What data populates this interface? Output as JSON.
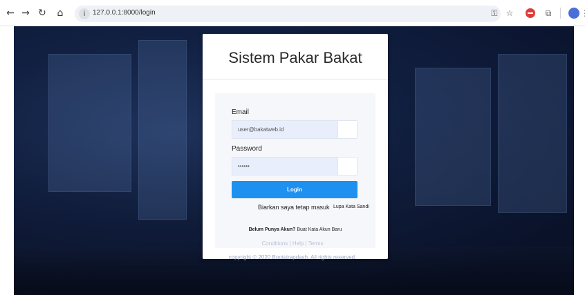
{
  "browser": {
    "url": "127.0.0.1:8000/login",
    "icons": {
      "back": "back-arrow-icon",
      "forward": "forward-arrow-icon",
      "reload": "reload-icon",
      "home": "home-icon",
      "site_info": "site-info-icon",
      "password_key": "key-icon",
      "bookmark": "star-icon",
      "extensions": "puzzle-icon",
      "menu": "kebab-menu-icon"
    }
  },
  "login": {
    "title": "Sistem Pakar Bakat",
    "email_label": "Email",
    "email_value": "user@bakatweb.id",
    "password_label": "Password",
    "password_value": "••••••",
    "login_button": "Login",
    "remember_label": "Biarkan saya tetap masuk",
    "forgot_link": "Lupa Kata Sandi",
    "signup_prompt": "Belum Punya Akun?",
    "signup_link": "Buat Kata Akun Baru"
  },
  "footer": {
    "links": [
      "Conditions",
      "Help",
      "Terms"
    ],
    "copyright": "copyright © 2020 Bootstrapdash. All rights reserved."
  },
  "colors": {
    "accent": "#1e90f0",
    "input_bg": "#e8eefc",
    "page_bg": "#0e1a38"
  }
}
